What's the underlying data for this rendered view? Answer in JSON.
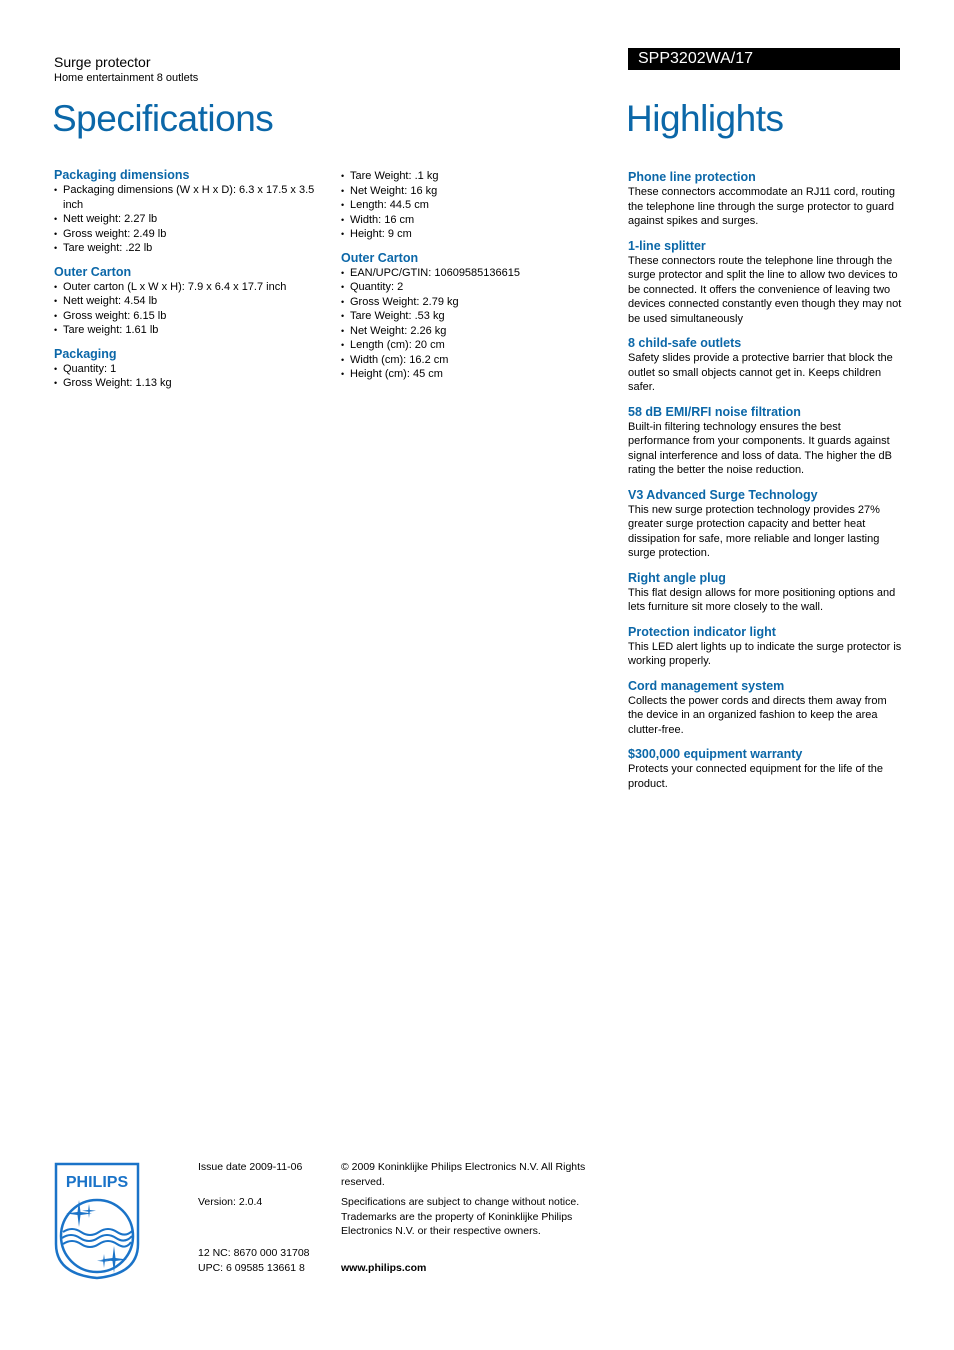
{
  "header": {
    "product_name": "Surge protector",
    "product_subtitle": "Home entertainment 8 outlets",
    "model_number": "SPP3202WA/17"
  },
  "specifications": {
    "title": "Specifications",
    "column1": [
      {
        "heading": "Packaging dimensions",
        "items": [
          "Packaging dimensions (W x H x D): 6.3 x 17.5 x 3.5 inch",
          "Nett weight: 2.27 lb",
          "Gross weight: 2.49 lb",
          "Tare weight: .22 lb"
        ]
      },
      {
        "heading": "Outer Carton",
        "items": [
          "Outer carton (L x W x H): 7.9 x 6.4 x 17.7 inch",
          "Nett weight: 4.54 lb",
          "Gross weight: 6.15 lb",
          "Tare weight: 1.61 lb"
        ]
      },
      {
        "heading": "Packaging",
        "items": [
          "Quantity: 1",
          "Gross Weight: 1.13 kg"
        ]
      }
    ],
    "column2": [
      {
        "heading": "",
        "items": [
          "Tare Weight: .1 kg",
          "Net Weight: 16 kg",
          "Length: 44.5 cm",
          "Width: 16 cm",
          "Height: 9 cm"
        ]
      },
      {
        "heading": "Outer Carton",
        "items": [
          "EAN/UPC/GTIN: 10609585136615",
          "Quantity: 2",
          "Gross Weight: 2.79 kg",
          "Tare Weight: .53 kg",
          "Net Weight: 2.26 kg",
          "Length (cm): 20 cm",
          "Width (cm): 16.2 cm",
          "Height (cm): 45 cm"
        ]
      }
    ]
  },
  "highlights": {
    "title": "Highlights",
    "items": [
      {
        "heading": "Phone line protection",
        "body": "These connectors accommodate an RJ11 cord, routing the telephone line through the surge protector to guard against spikes and surges."
      },
      {
        "heading": "1-line splitter",
        "body": "These connectors route the telephone line through the surge protector and split the line to allow two devices to be connected. It offers the convenience of leaving two devices connected constantly even though they may not be used simultaneously"
      },
      {
        "heading": "8 child-safe outlets",
        "body": "Safety slides provide a protective barrier that block the outlet so small objects cannot get in. Keeps children safer."
      },
      {
        "heading": "58 dB EMI/RFI noise filtration",
        "body": "Built-in filtering technology ensures the best performance from your components. It guards against signal interference and loss of data. The higher the dB rating the better the noise reduction."
      },
      {
        "heading": "V3 Advanced Surge Technology",
        "body": "This new surge protection technology provides 27% greater surge protection capacity and better heat dissipation for safe, more reliable and longer lasting surge protection."
      },
      {
        "heading": "Right angle plug",
        "body": "This flat design allows for more positioning options and lets furniture sit more closely to the wall."
      },
      {
        "heading": "Protection indicator light",
        "body": "This LED alert lights up to indicate the surge protector is working properly."
      },
      {
        "heading": "Cord management system",
        "body": "Collects the power cords and directs them away from the device in an organized fashion to keep the area clutter-free."
      },
      {
        "heading": "$300,000 equipment warranty",
        "body": "Protects your connected equipment for the life of the product."
      }
    ]
  },
  "footer": {
    "logo_text": "PHILIPS",
    "issue_date": "Issue date 2009-11-06",
    "version": "Version: 2.0.4",
    "nc": "12 NC: 8670 000 31708",
    "upc": "UPC: 6 09585 13661 8",
    "copyright": "© 2009 Koninklijke Philips Electronics N.V. All Rights reserved.",
    "disclaimer": "Specifications are subject to change without notice. Trademarks are the property of Koninklijke Philips Electronics N.V. or their respective owners.",
    "website": "www.philips.com"
  },
  "colors": {
    "accent_blue": "#0b67a8",
    "logo_blue": "#1a73c8",
    "model_bar_bg": "#000000"
  }
}
